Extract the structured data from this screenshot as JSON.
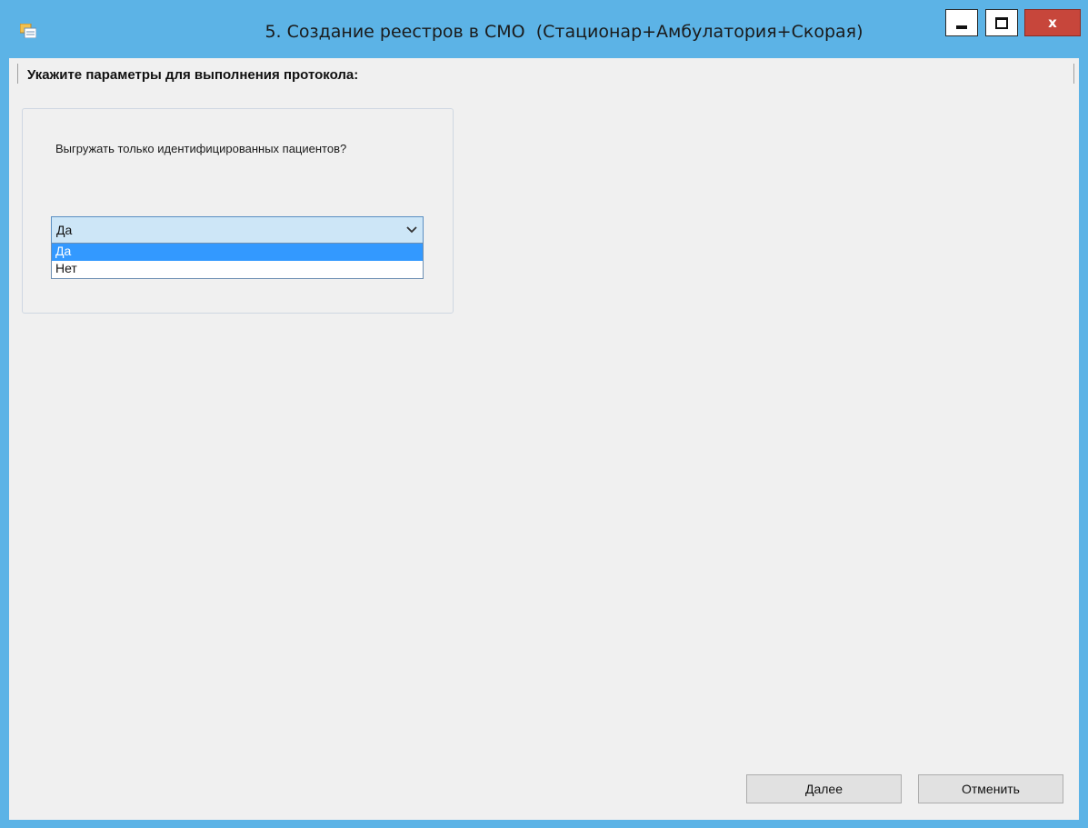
{
  "window": {
    "title": "5. Создание реестров в СМО  (Стационар+Амбулатория+Скорая)",
    "minimize_glyph": "minimize-icon",
    "maximize_glyph": "maximize-icon",
    "close_glyph": "x",
    "accent_color": "#5cb3e6",
    "close_color": "#c7463b"
  },
  "form": {
    "heading": "Укажите параметры для выполнения протокола:",
    "question": "Выгружать только идентифицированных пациентов?",
    "combo": {
      "selected_value": "Да",
      "options": [
        "Да",
        "Нет"
      ],
      "highlighted_index": 0
    }
  },
  "buttons": {
    "next_label": "Далее",
    "cancel_label": "Отменить"
  },
  "colors": {
    "selection": "#3399ff",
    "combo_background": "#cde6f7"
  }
}
